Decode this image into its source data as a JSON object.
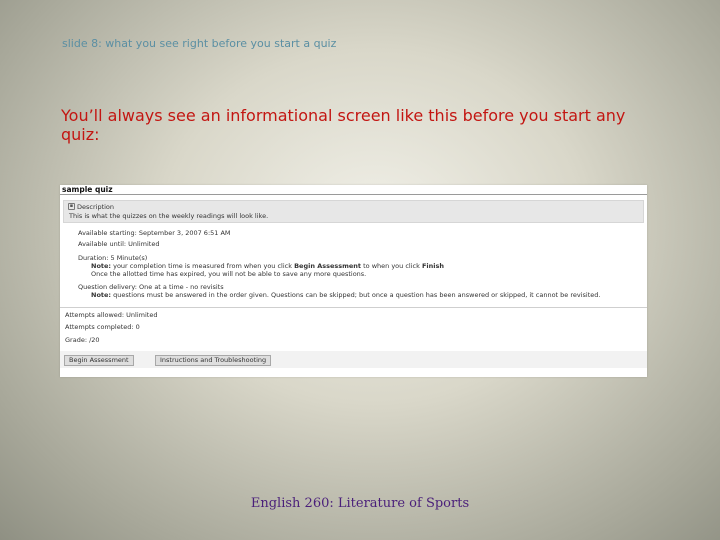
{
  "slide": {
    "header": "slide 8: what you see right before you start a quiz",
    "title": "You’ll always see an informational screen like this before you start any quiz:",
    "footer": "English 260: Literature of Sports"
  },
  "quiz": {
    "title": "sample quiz",
    "description_heading": "Description",
    "description_text": "This is what the quizzes on the weekly readings will look like.",
    "available_starting": "Available starting: September 3, 2007 6:51 AM",
    "available_until": "Available until: Unlimited",
    "duration": "Duration: 5 Minute(s)",
    "note1_label": "Note:",
    "note1_prefix": " your completion time is measured from when you click ",
    "note1_begin": "Begin Assessment",
    "note1_mid": " to when you click ",
    "note1_finish": "Finish",
    "note1_line2": "Once the allotted time has expired, you will not be able to save any more questions.",
    "question_delivery": "Question delivery: One at a time - no revisits",
    "note2_label": "Note:",
    "note2_text": " questions must be answered in the order given. Questions can be skipped; but once a question has been answered or skipped, it cannot be revisited.",
    "attempts_allowed": "Attempts allowed: Unlimited",
    "attempts_completed": "Attempts completed: 0",
    "grade": "Grade:  /20",
    "begin_button": "Begin Assessment",
    "instructions_button": "Instructions and Troubleshooting"
  }
}
